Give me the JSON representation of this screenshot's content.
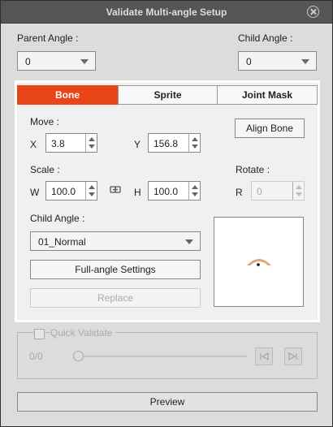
{
  "window": {
    "title": "Validate Multi-angle Setup"
  },
  "parent_angle": {
    "label": "Parent Angle :",
    "value": "0"
  },
  "child_angle_top": {
    "label": "Child Angle :",
    "value": "0"
  },
  "tabs": [
    {
      "label": "Bone",
      "active": true
    },
    {
      "label": "Sprite",
      "active": false
    },
    {
      "label": "Joint Mask",
      "active": false
    }
  ],
  "move": {
    "label": "Move :",
    "x_label": "X",
    "x_value": "3.8",
    "y_label": "Y",
    "y_value": "156.8"
  },
  "align_bone": {
    "label": "Align Bone"
  },
  "scale": {
    "label": "Scale :",
    "w_label": "W",
    "w_value": "100.0",
    "h_label": "H",
    "h_value": "100.0"
  },
  "rotate": {
    "label": "Rotate :",
    "r_label": "R",
    "r_value": "0"
  },
  "child_angle": {
    "label": "Child Angle :",
    "value": "01_Normal"
  },
  "full_angle_button": {
    "label": "Full-angle Settings"
  },
  "replace_button": {
    "label": "Replace"
  },
  "quick_validate": {
    "label": "Quick Validate",
    "checked": false,
    "progress_text": "0/0",
    "slider_value": 0
  },
  "preview_button": {
    "label": "Preview"
  },
  "colors": {
    "accent": "#e84619",
    "sprite": "#d9aa78"
  },
  "icons": {
    "close": "close-icon",
    "link": "link-icon",
    "prev": "step-back-icon",
    "next": "step-forward-icon"
  }
}
